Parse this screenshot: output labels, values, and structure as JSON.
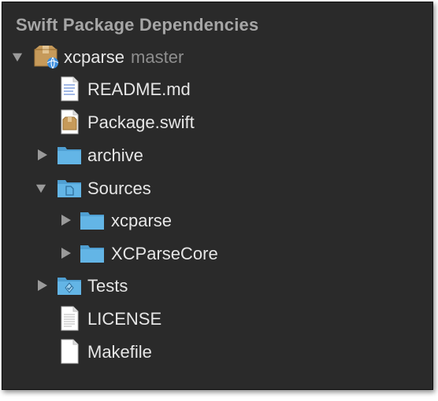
{
  "navigator": {
    "title": "Swift Package Dependencies",
    "root": {
      "name": "xcparse",
      "branch": "master",
      "expanded": true,
      "icon": "package-icon"
    },
    "items": [
      {
        "label": "README.md",
        "icon": "markdown-file-icon",
        "level": 1
      },
      {
        "label": "Package.swift",
        "icon": "package-swift-file-icon",
        "level": 1
      },
      {
        "label": "archive",
        "icon": "folder-icon",
        "level": 1,
        "expandable": true,
        "expanded": false
      },
      {
        "label": "Sources",
        "icon": "sources-folder-icon",
        "level": 1,
        "expandable": true,
        "expanded": true
      },
      {
        "label": "xcparse",
        "icon": "folder-icon",
        "level": 2,
        "expandable": true,
        "expanded": false
      },
      {
        "label": "XCParseCore",
        "icon": "folder-icon",
        "level": 2,
        "expandable": true,
        "expanded": false
      },
      {
        "label": "Tests",
        "icon": "tests-folder-icon",
        "level": 1,
        "expandable": true,
        "expanded": false
      },
      {
        "label": "LICENSE",
        "icon": "text-file-icon",
        "level": 1
      },
      {
        "label": "Makefile",
        "icon": "text-file-icon",
        "level": 1
      }
    ]
  },
  "colors": {
    "background": "#2a2a2a",
    "folder": "#5fb0e0",
    "text": "#e6e6e6",
    "secondary_text": "#8e8e8e",
    "header_text": "#a6a6a6"
  }
}
